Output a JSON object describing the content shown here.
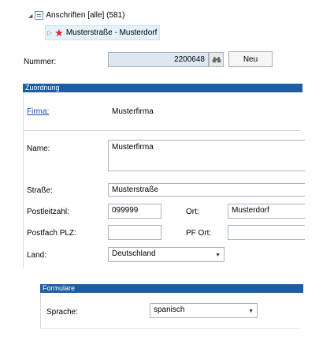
{
  "tree": {
    "root_label": "Anschriften [alle] (581)",
    "child_label": "Musterstraße - Musterdorf"
  },
  "header": {
    "nummer_label": "Nummer:",
    "nummer_value": "2200648",
    "neu_button": "Neu"
  },
  "zuordnung": {
    "section_title": "Zuordnung",
    "firma_label": "Firma:",
    "firma_value": "Musterfirma",
    "name_label": "Name:",
    "name_value": "Musterfirma",
    "strasse_label": "Straße:",
    "strasse_value": "Musterstraße",
    "plz_label": "Postleitzahl:",
    "plz_value": "099999",
    "ort_label": "Ort:",
    "ort_value": "Musterdorf",
    "postfach_label": "Postfach PLZ:",
    "postfach_value": "",
    "pf_ort_label": "PF Ort:",
    "pf_ort_value": "",
    "land_label": "Land:",
    "land_value": "Deutschland"
  },
  "formulare": {
    "section_title": "Formulare",
    "sprache_label": "Sprache:",
    "sprache_value": "spanisch"
  },
  "colors": {
    "section_bar": "#1d5da4",
    "link": "#1a4fb8",
    "star": "#e02121"
  },
  "icons": {
    "expand": "expanded-arrow-icon",
    "collapse": "collapsed-arrow-icon",
    "folder": "list-folder-icon",
    "star": "star-icon",
    "binoculars": "binoculars-icon",
    "dropdown": "chevron-down-icon"
  }
}
